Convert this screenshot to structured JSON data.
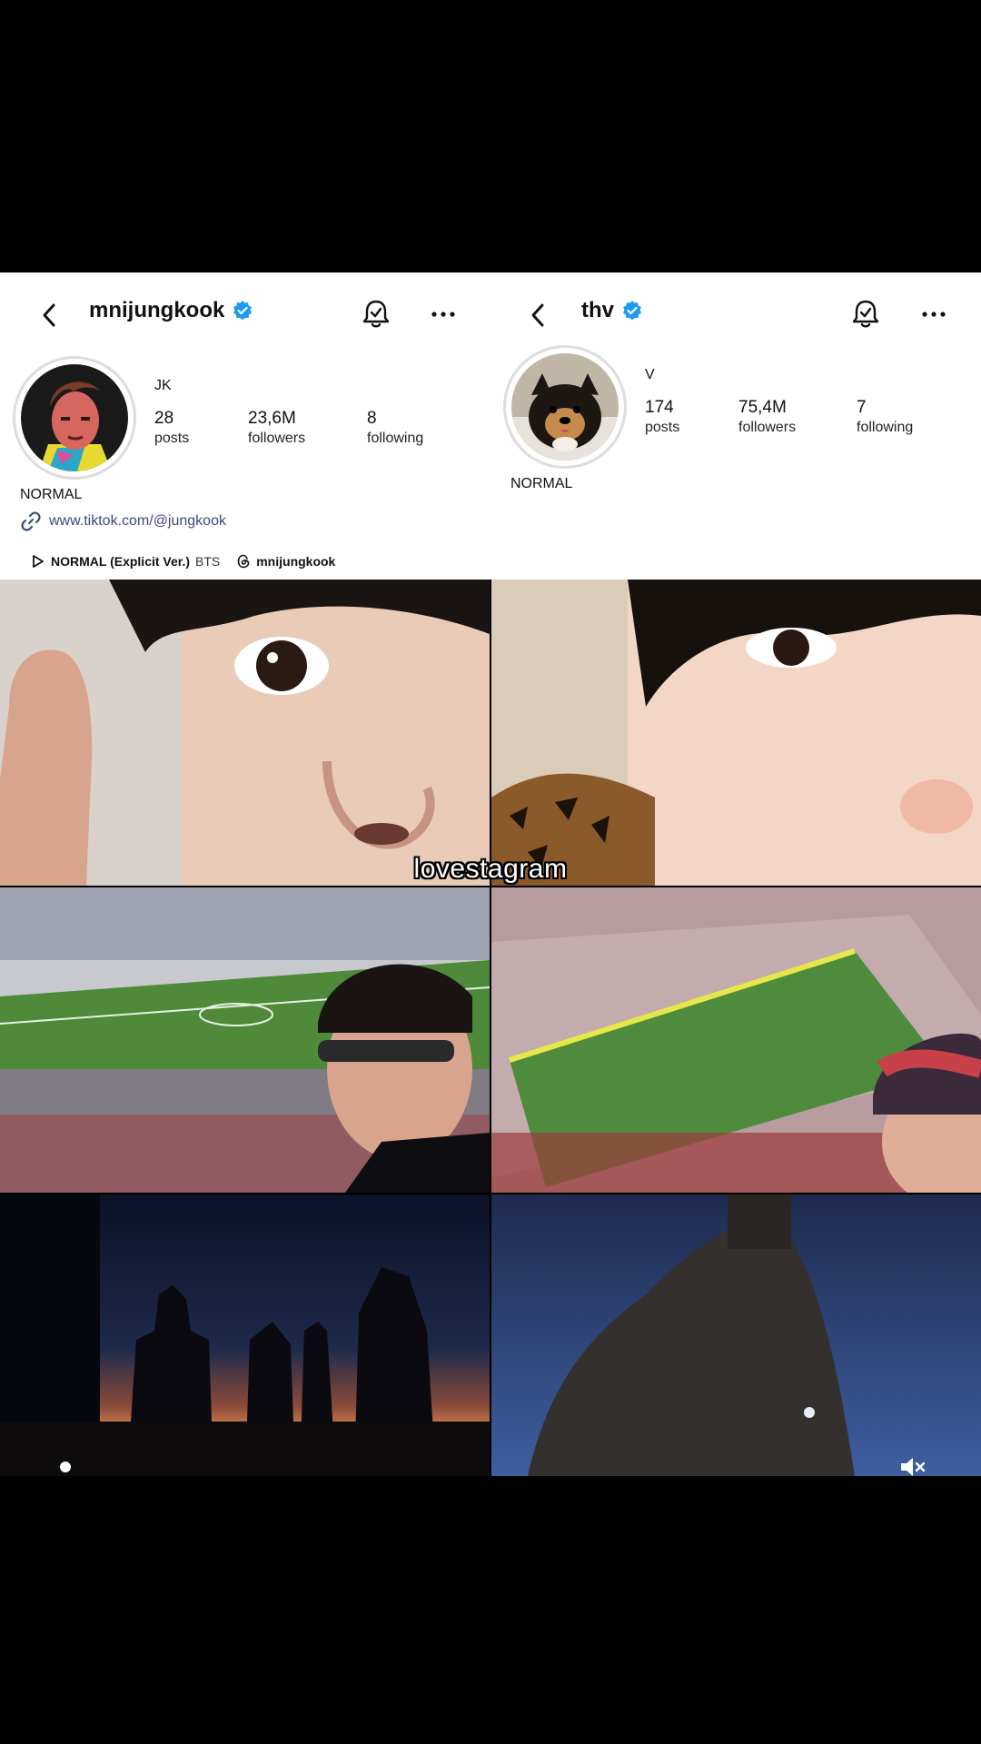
{
  "caption": "lovestagram",
  "left_profile": {
    "username": "mnijungkook",
    "display_name": "JK",
    "stats": [
      {
        "num": "28",
        "label": "posts"
      },
      {
        "num": "23,6M",
        "label": "followers"
      },
      {
        "num": "8",
        "label": "following"
      }
    ],
    "bio": "NORMAL",
    "link": "www.tiktok.com/@jungkook",
    "music_title": "NORMAL (Explicit Ver.)",
    "music_artist": "BTS",
    "threads_handle": "mnijungkook"
  },
  "right_profile": {
    "username": "thv",
    "display_name": "V",
    "stats": [
      {
        "num": "174",
        "label": "posts"
      },
      {
        "num": "75,4M",
        "label": "followers"
      },
      {
        "num": "7",
        "label": "following"
      }
    ],
    "bio": "NORMAL"
  },
  "colors": {
    "verified": "#1d9bf0",
    "link": "#3b4a78"
  },
  "icons": {
    "back": "chevron-left",
    "verified": "verified-badge",
    "bell": "notification-bell",
    "more": "ellipsis",
    "link": "chain-link",
    "music": "play-triangle",
    "threads": "threads-logo",
    "mute": "speaker-muted"
  }
}
